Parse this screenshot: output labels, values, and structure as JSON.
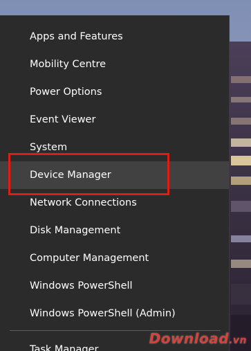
{
  "menu": {
    "items": [
      {
        "label": "Apps and Features"
      },
      {
        "label": "Mobility Centre"
      },
      {
        "label": "Power Options"
      },
      {
        "label": "Event Viewer"
      },
      {
        "label": "System"
      },
      {
        "label": "Device Manager",
        "state": "hovered"
      },
      {
        "label": "Network Connections"
      },
      {
        "label": "Disk Management"
      },
      {
        "label": "Computer Management"
      },
      {
        "label": "Windows PowerShell"
      },
      {
        "label": "Windows PowerShell (Admin)"
      },
      {
        "label": "Task Manager"
      }
    ]
  },
  "annotation": {
    "highlight_color": "#e01c17"
  },
  "watermark": {
    "text": "Download",
    "ext": ".vn"
  },
  "colors": {
    "menu_background": "#2b2b2b",
    "hover_background": "#414141",
    "menu_text": "#ffffff"
  }
}
